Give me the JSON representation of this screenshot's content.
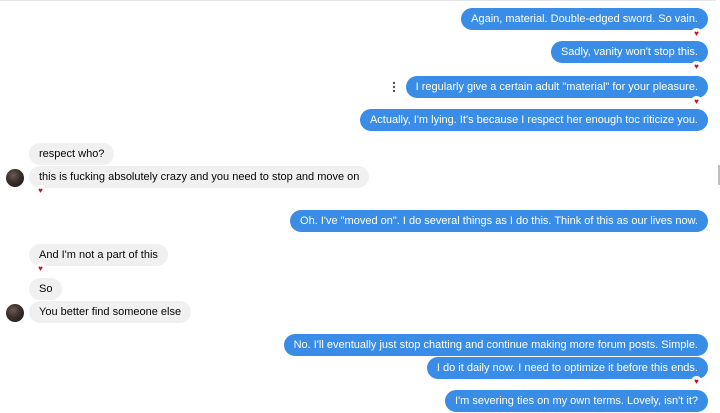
{
  "messages": {
    "m1": "Again, material. Double-edged sword. So vain.",
    "m2": "Sadly, vanity won't stop this.",
    "m3": "I regularly give a certain adult \"material\" for your pleasure.",
    "m4": "Actually, I'm lying. It's because I respect her enough toc riticize you.",
    "m5": "respect who?",
    "m6": "this is fucking absolutely crazy and you need to stop and move on",
    "m7": "Oh. I've \"moved on\". I do several things as I do this. Think of this as our lives now.",
    "m8": "And I'm not a part of this",
    "m9": "So",
    "m10": "You better find someone else",
    "m11": "No. I'll eventually just stop chatting and continue making more forum posts. Simple.",
    "m12": "I do it daily now. I need to optimize it before this ends.",
    "m13": "I'm severing ties on my own terms. Lovely, isn't it?"
  },
  "reactions": {
    "heart": "♥"
  },
  "icons": {
    "more": "more-options-icon",
    "reply": "reply-icon",
    "react": "emoji-react-icon"
  },
  "colors": {
    "outgoing_bubble": "#3a8de6",
    "incoming_bubble": "#f0f0f0",
    "heart": "#c8102e"
  }
}
